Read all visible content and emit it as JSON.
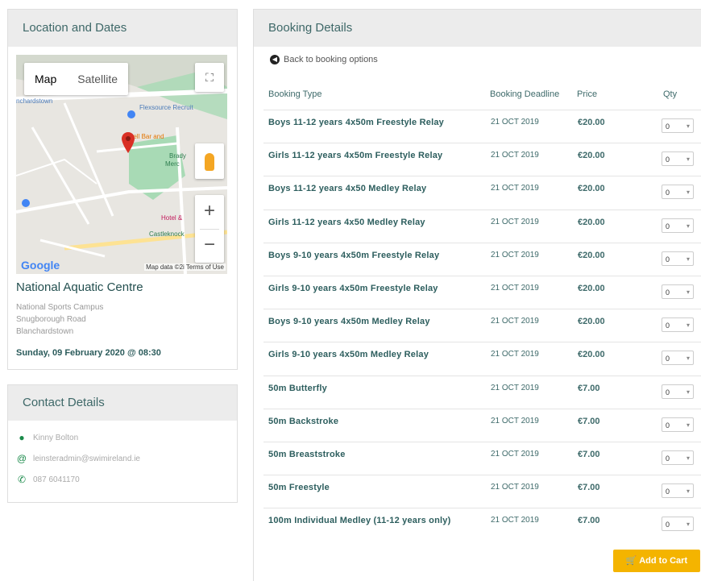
{
  "location": {
    "title": "Location and Dates",
    "map": {
      "tab_map": "Map",
      "tab_satellite": "Satellite",
      "logo": "Google",
      "footer": "Map data ©2i Terms of Use",
      "labels": [
        "Flexsource Recruit",
        "Bell Bar and",
        "Brady",
        "Merc",
        "Hotel &",
        "Castleknock",
        "nchardstown",
        "alowa",
        "stown"
      ]
    },
    "venue": "National Aquatic Centre",
    "address_1": "National Sports Campus",
    "address_2": "Snugborough Road",
    "address_3": "Blanchardstown",
    "date": "Sunday, 09 February 2020 @ 08:30"
  },
  "contact": {
    "title": "Contact Details",
    "name": "Kinny Bolton",
    "email": "leinsteradmin@swimireland.ie",
    "phone": "087 6041170"
  },
  "booking": {
    "title": "Booking Details",
    "back": "Back to booking options",
    "headers": {
      "type": "Booking Type",
      "deadline": "Booking Deadline",
      "price": "Price",
      "qty": "Qty"
    },
    "rows": [
      {
        "type": "Boys 11-12 years 4x50m Freestyle Relay",
        "deadline": "21 OCT 2019",
        "price": "€20.00",
        "qty": "0"
      },
      {
        "type": "Girls 11-12 years 4x50m Freestyle Relay",
        "deadline": "21 OCT 2019",
        "price": "€20.00",
        "qty": "0"
      },
      {
        "type": "Boys 11-12 years 4x50 Medley Relay",
        "deadline": "21 OCT 2019",
        "price": "€20.00",
        "qty": "0"
      },
      {
        "type": "Girls 11-12 years 4x50 Medley Relay",
        "deadline": "21 OCT 2019",
        "price": "€20.00",
        "qty": "0"
      },
      {
        "type": "Boys 9-10 years 4x50m Freestyle Relay",
        "deadline": "21 OCT 2019",
        "price": "€20.00",
        "qty": "0"
      },
      {
        "type": "Girls 9-10 years 4x50m Freestyle Relay",
        "deadline": "21 OCT 2019",
        "price": "€20.00",
        "qty": "0"
      },
      {
        "type": "Boys 9-10 years 4x50m Medley Relay",
        "deadline": "21 OCT 2019",
        "price": "€20.00",
        "qty": "0"
      },
      {
        "type": "Girls 9-10 years 4x50m Medley Relay",
        "deadline": "21 OCT 2019",
        "price": "€20.00",
        "qty": "0"
      },
      {
        "type": "50m Butterfly",
        "deadline": "21 OCT 2019",
        "price": "€7.00",
        "qty": "0"
      },
      {
        "type": "50m Backstroke",
        "deadline": "21 OCT 2019",
        "price": "€7.00",
        "qty": "0"
      },
      {
        "type": "50m Breaststroke",
        "deadline": "21 OCT 2019",
        "price": "€7.00",
        "qty": "0"
      },
      {
        "type": "50m Freestyle",
        "deadline": "21 OCT 2019",
        "price": "€7.00",
        "qty": "0"
      },
      {
        "type": "100m Individual Medley (11-12 years only)",
        "deadline": "21 OCT 2019",
        "price": "€7.00",
        "qty": "0"
      }
    ],
    "add_to_cart": "Add to Cart"
  },
  "colors": {
    "accent": "#f4b400",
    "heading": "#3e6868",
    "panel_head_bg": "#ececec",
    "pin": "#d93025",
    "park": "#a8dab5"
  },
  "icons": [
    "back-circle-icon",
    "person-icon",
    "at-icon",
    "phone-icon",
    "cart-icon",
    "map-pin-icon",
    "pegman-icon",
    "fullscreen-icon"
  ]
}
